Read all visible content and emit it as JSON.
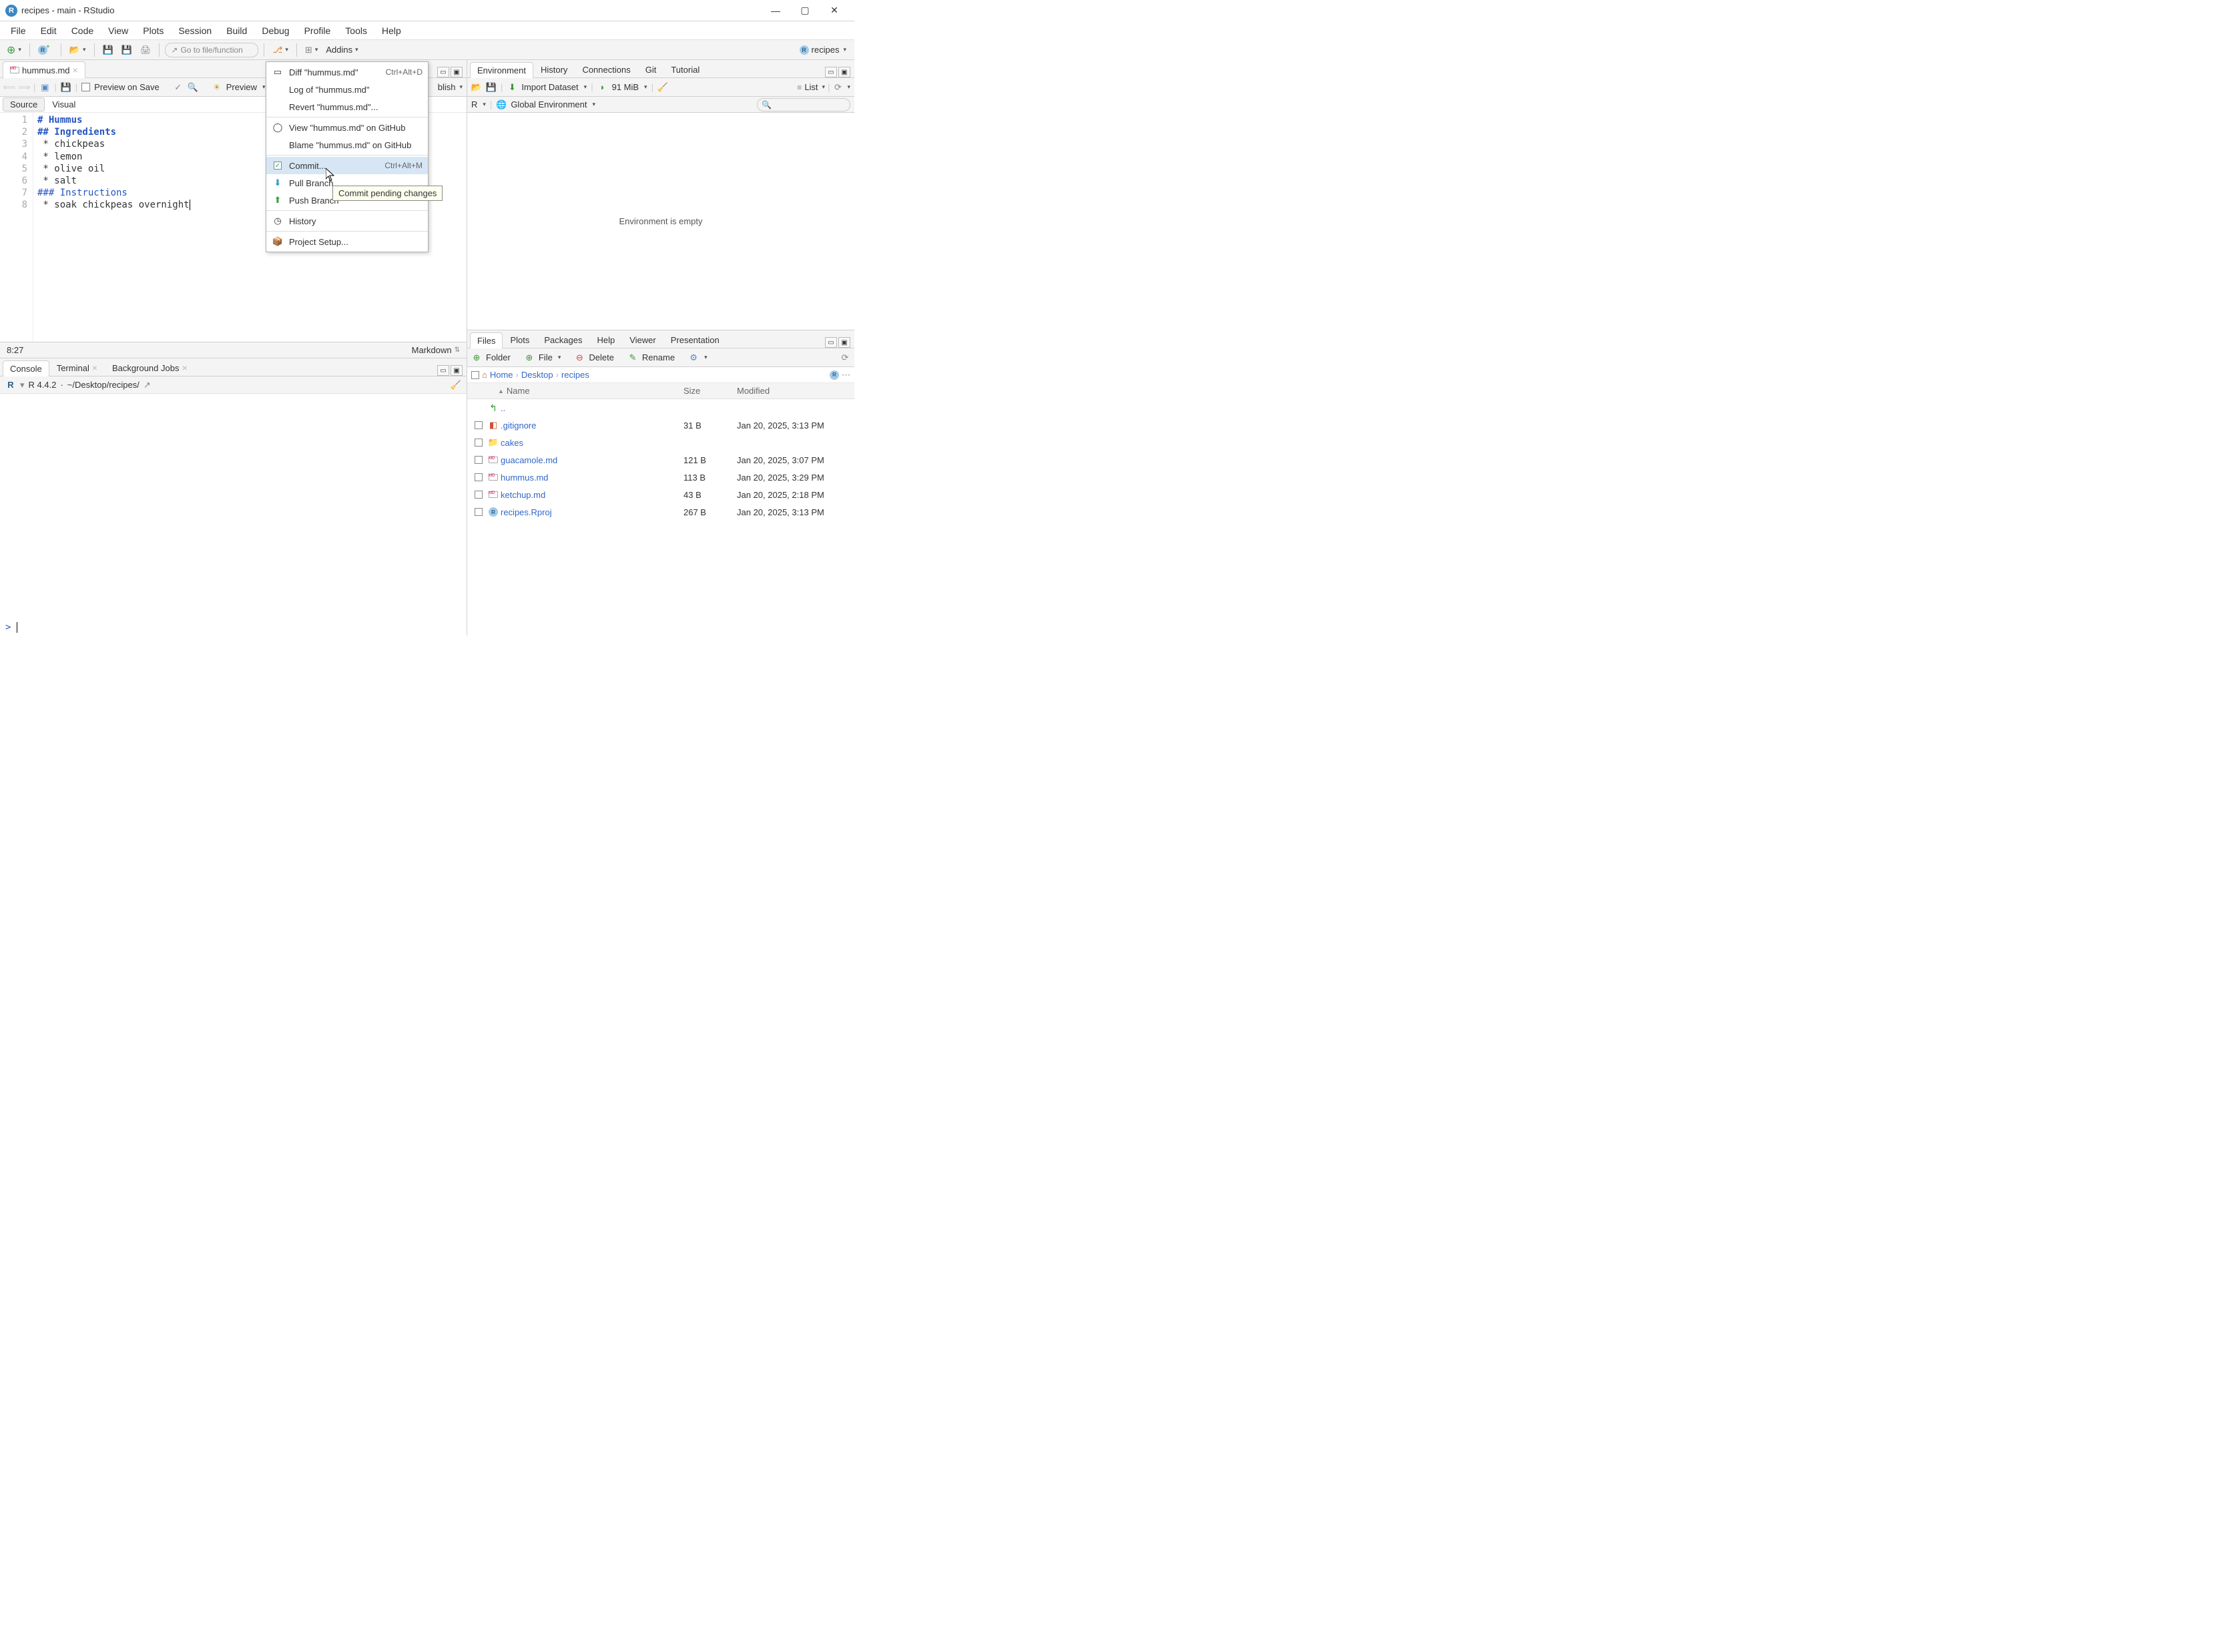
{
  "window": {
    "title": "recipes - main - RStudio"
  },
  "menubar": [
    "File",
    "Edit",
    "Code",
    "View",
    "Plots",
    "Session",
    "Build",
    "Debug",
    "Profile",
    "Tools",
    "Help"
  ],
  "toolbar": {
    "goto_placeholder": "Go to file/function",
    "addins": "Addins",
    "project": "recipes"
  },
  "source_pane": {
    "tab": "hummus.md",
    "preview_on_save": "Preview on Save",
    "preview_btn": "Preview",
    "publish": "blish",
    "views": {
      "source": "Source",
      "visual": "Visual"
    },
    "lines": [
      {
        "n": 1,
        "cls": "h1",
        "t": "# Hummus"
      },
      {
        "n": 2,
        "cls": "h2",
        "t": "## Ingredients"
      },
      {
        "n": 3,
        "cls": "li",
        "t": " * chickpeas"
      },
      {
        "n": 4,
        "cls": "li",
        "t": " * lemon"
      },
      {
        "n": 5,
        "cls": "li",
        "t": " * olive oil"
      },
      {
        "n": 6,
        "cls": "li",
        "t": " * salt"
      },
      {
        "n": 7,
        "cls": "h3",
        "t": "### Instructions"
      },
      {
        "n": 8,
        "cls": "li",
        "t": " * soak chickpeas overnight"
      }
    ],
    "status": {
      "pos": "8:27",
      "lang": "Markdown"
    }
  },
  "context_menu": {
    "items": [
      {
        "icon": "diff-icon",
        "label": "Diff \"hummus.md\"",
        "shortcut": "Ctrl+Alt+D",
        "glyph": "▭"
      },
      {
        "icon": "log-icon",
        "label": "Log of \"hummus.md\"",
        "shortcut": ""
      },
      {
        "icon": "revert-icon",
        "label": "Revert \"hummus.md\"...",
        "shortcut": ""
      },
      {
        "sep": true
      },
      {
        "icon": "github-icon",
        "label": "View \"hummus.md\" on GitHub",
        "shortcut": "",
        "glyph": "◯"
      },
      {
        "icon": "blame-icon",
        "label": "Blame \"hummus.md\" on GitHub",
        "shortcut": ""
      },
      {
        "sep": true
      },
      {
        "icon": "commit-icon",
        "label": "Commit...",
        "shortcut": "Ctrl+Alt+M",
        "hover": true,
        "check": true
      },
      {
        "icon": "pull-icon",
        "label": "Pull Branches",
        "truncate": "Pull Branch",
        "shortcut": "",
        "glyph": "⬇",
        "color": "#2aa0c8"
      },
      {
        "icon": "push-icon",
        "label": "Push Branch",
        "shortcut": "",
        "glyph": "⬆",
        "color": "#3a9b3a"
      },
      {
        "sep": true
      },
      {
        "icon": "history-icon",
        "label": "History",
        "shortcut": "",
        "glyph": "◷"
      },
      {
        "sep": true
      },
      {
        "icon": "setup-icon",
        "label": "Project Setup...",
        "shortcut": "",
        "glyph": "📦"
      }
    ],
    "tooltip": "Commit pending changes"
  },
  "console_pane": {
    "tabs": [
      "Console",
      "Terminal",
      "Background Jobs"
    ],
    "version": "R 4.4.2",
    "path": "~/Desktop/recipes/",
    "prompt": ">"
  },
  "env_pane": {
    "tabs": [
      "Environment",
      "History",
      "Connections",
      "Git",
      "Tutorial"
    ],
    "toolbar": {
      "import": "Import Dataset",
      "mem": "91 MiB",
      "list": "List",
      "scope_r": "R",
      "scope_env": "Global Environment"
    },
    "empty": "Environment is empty"
  },
  "files_pane": {
    "tabs": [
      "Files",
      "Plots",
      "Packages",
      "Help",
      "Viewer",
      "Presentation"
    ],
    "toolbar": {
      "folder": "Folder",
      "file": "File",
      "delete": "Delete",
      "rename": "Rename"
    },
    "breadcrumb": [
      "Home",
      "Desktop",
      "recipes"
    ],
    "columns": {
      "name": "Name",
      "size": "Size",
      "modified": "Modified"
    },
    "up": "..",
    "rows": [
      {
        "icon": "text",
        "name": ".gitignore",
        "size": "31 B",
        "modified": "Jan 20, 2025, 3:13 PM"
      },
      {
        "icon": "folder",
        "name": "cakes",
        "size": "",
        "modified": ""
      },
      {
        "icon": "md",
        "name": "guacamole.md",
        "size": "121 B",
        "modified": "Jan 20, 2025, 3:07 PM"
      },
      {
        "icon": "md",
        "name": "hummus.md",
        "size": "113 B",
        "modified": "Jan 20, 2025, 3:29 PM"
      },
      {
        "icon": "md",
        "name": "ketchup.md",
        "size": "43 B",
        "modified": "Jan 20, 2025, 2:18 PM"
      },
      {
        "icon": "rproj",
        "name": "recipes.Rproj",
        "size": "267 B",
        "modified": "Jan 20, 2025, 3:13 PM"
      }
    ]
  }
}
